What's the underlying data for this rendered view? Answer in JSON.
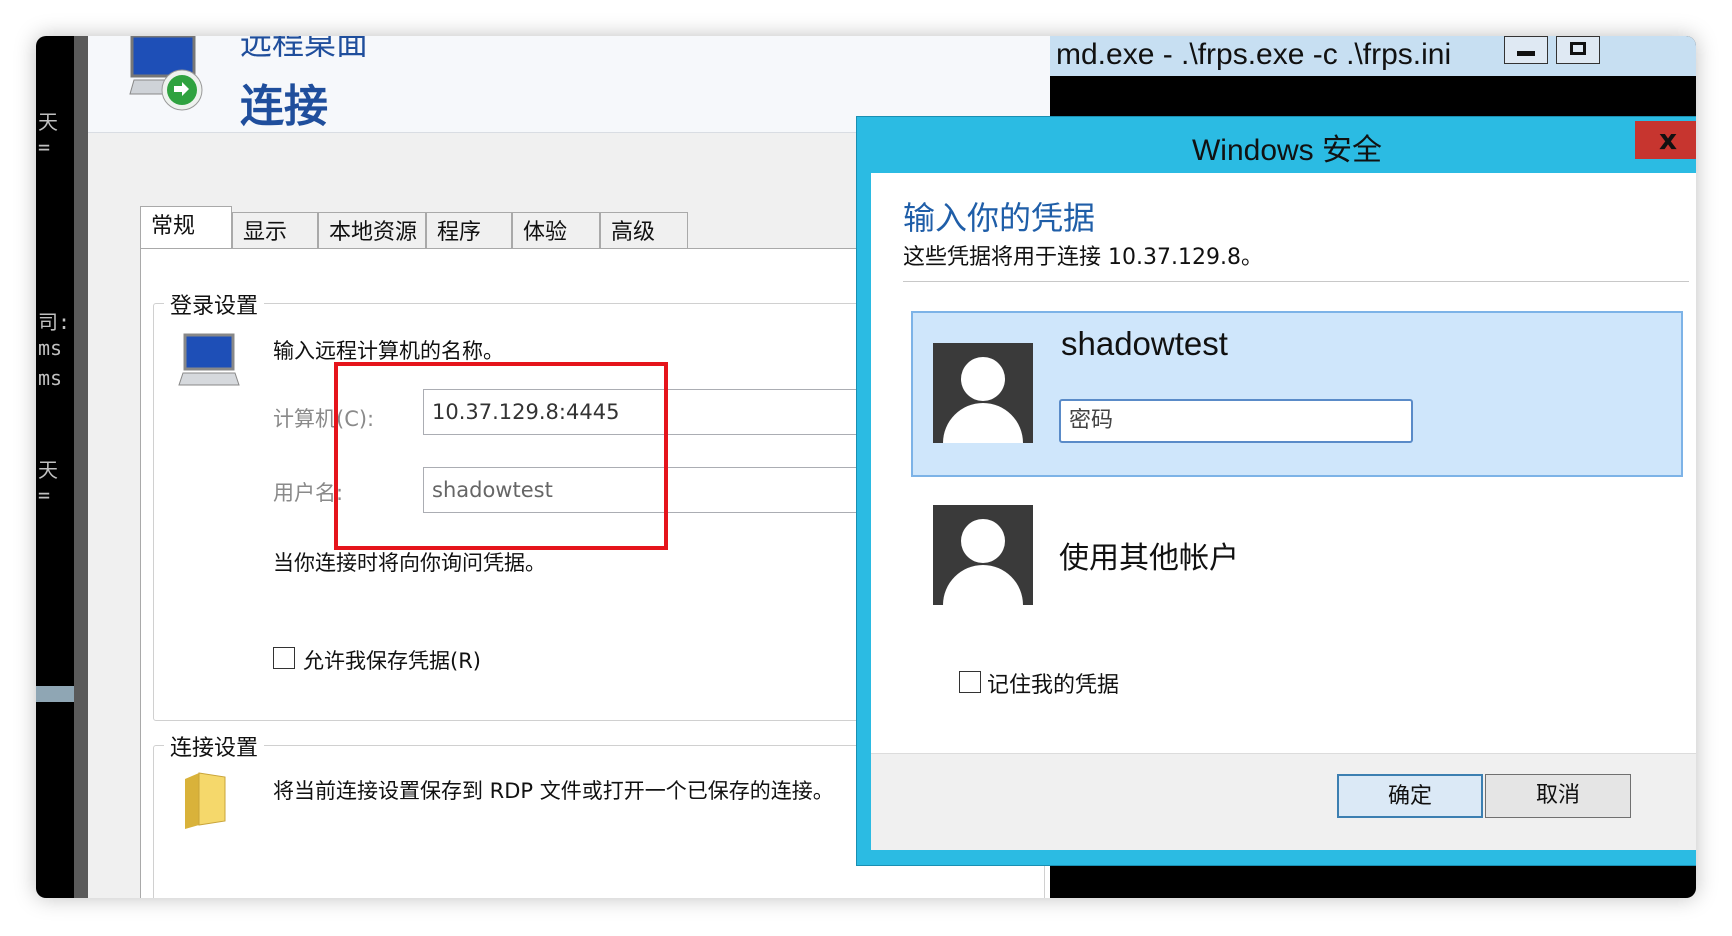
{
  "console_left": {
    "lines": [
      "天 =",
      "司:",
      "ms",
      "ms",
      "天 ="
    ]
  },
  "rdp": {
    "subtitle": "远程桌面",
    "title": "连接",
    "tabs": [
      "常规",
      "显示",
      "本地资源",
      "程序",
      "体验",
      "高级"
    ],
    "logon": {
      "legend": "登录设置",
      "prompt": "输入远程计算机的名称。",
      "computer_label": "计算机(C):",
      "computer_value": "10.37.129.8:4445",
      "username_label": "用户名:",
      "username_value": "shadowtest",
      "ask_note": "当你连接时将向你询问凭据。",
      "allow_save_label": "允许我保存凭据(R)"
    },
    "connection": {
      "legend": "连接设置",
      "text": "将当前连接设置保存到 RDP 文件或打开一个已保存的连接。"
    }
  },
  "console_window": {
    "title": "md.exe - .\\frps.exe  -c .\\frps.ini"
  },
  "security_dialog": {
    "title": "Windows 安全",
    "close_glyph": "x",
    "heading": "输入你的凭据",
    "description": "这些凭据将用于连接 10.37.129.8。",
    "account_username": "shadowtest",
    "password_placeholder": "密码",
    "other_account": "使用其他帐户",
    "remember_label": "记住我的凭据",
    "ok_label": "确定",
    "cancel_label": "取消"
  },
  "colors": {
    "dialog_border": "#2bbbe3",
    "heading_blue": "#1f5ea8",
    "highlight_red": "#e5141b",
    "selected_tile": "#cfe6fb"
  }
}
